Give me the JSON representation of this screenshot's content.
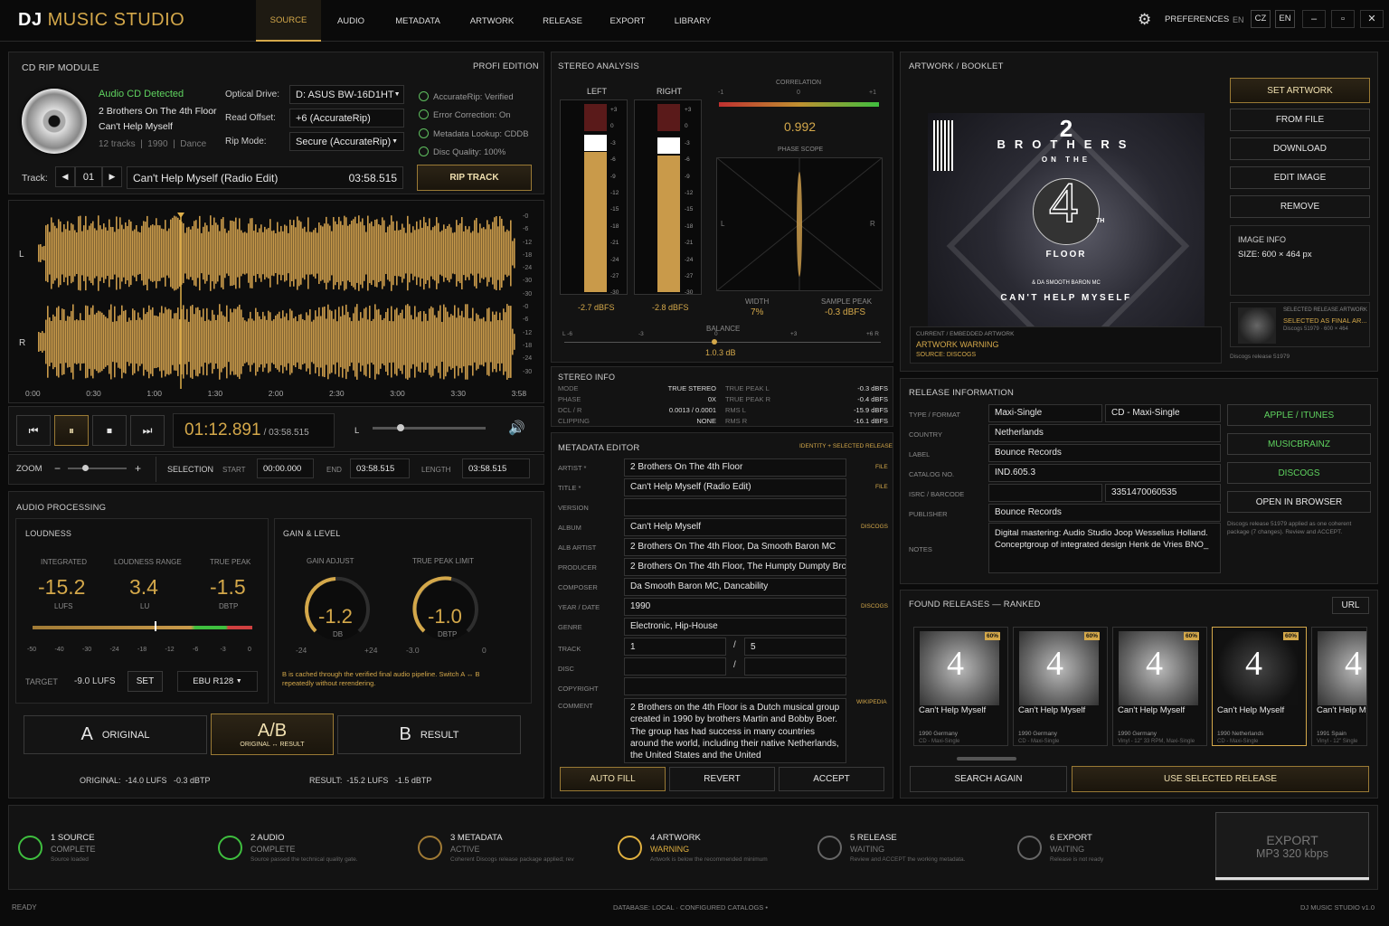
{
  "app": {
    "logo_dj": "DJ",
    "logo_rest": "MUSIC STUDIO",
    "tabs": [
      "SOURCE",
      "AUDIO",
      "METADATA",
      "ARTWORK",
      "RELEASE",
      "EXPORT",
      "LIBRARY"
    ],
    "active_tab": "SOURCE",
    "preferences": "PREFERENCES",
    "lang": [
      "EN",
      "CZ",
      "EN"
    ],
    "win": [
      "–",
      "▫",
      "✕"
    ]
  },
  "cdrip": {
    "title": "CD RIP MODULE",
    "edition": "PROFI EDITION",
    "detected": "Audio CD Detected",
    "artist": "2 Brothers On The 4th Floor",
    "album": "Can't Help Myself",
    "info": "12 tracks  |  1990  |  Dance",
    "drive_label": "Optical Drive:",
    "drive": "D: ASUS BW-16D1HT",
    "offset_label": "Read Offset:",
    "offset": "+6 (AccurateRip)",
    "mode_label": "Rip Mode:",
    "mode": "Secure (AccurateRip)",
    "checks": [
      "AccurateRip: Verified",
      "Error Correction: On",
      "Metadata Lookup: CDDB",
      "Disc Quality: 100%"
    ],
    "track_label": "Track:",
    "track_num": "01",
    "track_name": "Can't Help Myself (Radio Edit)",
    "track_time": "03:58.515",
    "rip": "RIP TRACK"
  },
  "wave": {
    "L": "L",
    "R": "R",
    "times": [
      "0:00",
      "0:30",
      "1:00",
      "1:30",
      "2:00",
      "2:30",
      "3:00",
      "3:30",
      "3:58"
    ],
    "db": [
      "-0",
      "-6",
      "-12",
      "-18",
      "-24",
      "-30",
      "-30",
      "-0",
      "-6",
      "-12",
      "-18",
      "-24",
      "-30"
    ]
  },
  "transport": {
    "time": "01:12.891",
    "total": "/ 03:58.515",
    "vol_label": "L"
  },
  "zoom": {
    "label": "ZOOM",
    "sel": "SELECTION",
    "start_l": "START",
    "start": "00:00.000",
    "end_l": "END",
    "end": "03:58.515",
    "len_l": "LENGTH",
    "len": "03:58.515"
  },
  "proc": {
    "title": "AUDIO PROCESSING",
    "loud": "LOUDNESS",
    "gain": "GAIN & LEVEL",
    "int_l": "INTEGRATED",
    "int": "-15.2",
    "int_u": "LUFS",
    "lra_l": "LOUDNESS RANGE",
    "lra": "3.4",
    "lra_u": "LU",
    "tp_l": "TRUE PEAK",
    "tp": "-1.5",
    "tp_u": "dBTP",
    "scale": [
      "-50",
      "-40",
      "-30",
      "-24",
      "-18",
      "-12",
      "-6",
      "-3",
      "0"
    ],
    "target_l": "TARGET",
    "target": "-9.0 LUFS",
    "set": "SET",
    "std": "EBU R128",
    "ga_l": "GAIN ADJUST",
    "ga": "-1.2",
    "ga_u": "dB",
    "ga_min": "-24",
    "ga_max": "+24",
    "tpl_l": "TRUE PEAK LIMIT",
    "tpl": "-1.0",
    "tpl_u": "dBTP",
    "tpl_min": "-3.0",
    "tpl_max": "0",
    "note": "B is cached through the verified final audio pipeline. Switch A ↔ B repeatedly without rerendering.",
    "a": "A",
    "a_l": "ORIGINAL",
    "ab": "A/B",
    "ab_l": "ORIGINAL ↔ RESULT",
    "b": "B",
    "b_l": "RESULT",
    "orig_stat": "ORIGINAL:  -14.0 LUFS   -0.3 dBTP",
    "res_stat": "RESULT:  -15.2 LUFS   -1.5 dBTP"
  },
  "stereo": {
    "title": "STEREO ANALYSIS",
    "left": "LEFT",
    "right": "RIGHT",
    "scale": [
      "+3",
      "0",
      "-3",
      "-6",
      "-9",
      "-12",
      "-15",
      "-18",
      "-21",
      "-24",
      "-27",
      "-30"
    ],
    "l_val": "-2.7 dBFS",
    "r_val": "-2.8 dBFS",
    "corr_l": "CORRELATION",
    "corr_m1": "-1",
    "corr_0": "0",
    "corr_p1": "+1",
    "corr": "0.992",
    "phase": "PHASE SCOPE",
    "ps_l": "L",
    "ps_r": "R",
    "width_l": "WIDTH",
    "width": "7%",
    "sp_l": "SAMPLE PEAK",
    "sp": "-0.3 dBFS",
    "bal_l": "BALANCE",
    "bal_scale": [
      "L -6",
      "-3",
      "0",
      "+3",
      "+6 R"
    ],
    "bal": "1.0.3 dB"
  },
  "sinfo": {
    "title": "STEREO INFO",
    "rows": [
      [
        "MODE",
        "TRUE STEREO",
        "TRUE PEAK L",
        "-0.3 dBFS"
      ],
      [
        "PHASE",
        "0X",
        "TRUE PEAK R",
        "-0.4 dBFS"
      ],
      [
        "DCL / R",
        "0.0013 / 0.0001",
        "RMS L",
        "-15.9 dBFS"
      ],
      [
        "CLIPPING",
        "NONE",
        "RMS R",
        "-16.1 dBFS"
      ]
    ]
  },
  "meta": {
    "title": "METADATA EDITOR",
    "sub": "IDENTITY + SELECTED RELEASE",
    "rows": [
      [
        "ARTIST *",
        "2 Brothers On The 4th Floor",
        "FILE"
      ],
      [
        "TITLE *",
        "Can't Help Myself (Radio Edit)",
        "FILE"
      ],
      [
        "VERSION",
        "",
        ""
      ],
      [
        "ALBUM",
        "Can't Help Myself",
        "DISCOGS"
      ],
      [
        "ALB ARTIST",
        "2 Brothers On The 4th Floor, Da Smooth Baron MC",
        ""
      ],
      [
        "PRODUCER",
        "2 Brothers On The 4th Floor, The Humpty Dumpty Brc",
        ""
      ],
      [
        "COMPOSER",
        "Da Smooth Baron MC, Dancability",
        ""
      ],
      [
        "YEAR / DATE",
        "1990",
        "DISCOGS"
      ],
      [
        "GENRE",
        "Electronic, Hip-House",
        ""
      ]
    ],
    "track_l": "TRACK",
    "track": "1",
    "track_of": "5",
    "disc_l": "DISC",
    "slash": "/",
    "copy_l": "COPYRIGHT",
    "comment_l": "COMMENT",
    "comment_src": "WIKIPEDIA",
    "comment": "2 Brothers on the 4th Floor is a Dutch musical group created in 1990 by brothers Martin and Bobby Boer. The group has had success in many countries around the world, including their native Netherlands, the United States and the United",
    "autofill": "AUTO FILL",
    "revert": "REVERT",
    "accept": "ACCEPT"
  },
  "art": {
    "title": "ARTWORK / BOOKLET",
    "cover_line1": "2",
    "cover_line2": "BROTHERS",
    "cover_line3": "ON THE",
    "cover_num": "4",
    "cover_th": "TH",
    "cover_floor": "FLOOR",
    "cover_mc": "& DA SMOOTH BARON MC",
    "cover_title": "CAN'T HELP MYSELF",
    "buttons": [
      "SET ARTWORK",
      "FROM FILE",
      "DOWNLOAD",
      "EDIT IMAGE",
      "REMOVE"
    ],
    "info_l": "IMAGE INFO",
    "size": "SIZE: 600 × 464 px",
    "cur_l": "CURRENT / EMBEDDED ARTWORK",
    "warn": "ARTWORK WARNING",
    "src": "SOURCE: DISCOGS",
    "sel_l": "SELECTED RELEASE ARTWORK",
    "sel_t": "SELECTED AS FINAL AR...",
    "sel_d": "Discogs 51979 · 600 × 464",
    "sel_n": "Discogs release 51979"
  },
  "rel": {
    "title": "RELEASE INFORMATION",
    "rows": [
      [
        "TYPE / FORMAT",
        "Maxi-Single",
        "CD - Maxi-Single"
      ],
      [
        "COUNTRY",
        "Netherlands",
        ""
      ],
      [
        "LABEL",
        "Bounce Records",
        ""
      ],
      [
        "CATALOG NO.",
        "IND.605.3",
        ""
      ],
      [
        "ISRC / BARCODE",
        "",
        "3351470060535"
      ],
      [
        "PUBLISHER",
        "Bounce Records",
        ""
      ]
    ],
    "notes_l": "NOTES",
    "notes": "Digital mastering: Audio Studio Joop Wesselius Holland. Conceptgroup of integrated design Henk de Vries BNO_",
    "links": [
      "APPLE / ITUNES",
      "MUSICBRAINZ",
      "DISCOGS",
      "OPEN IN BROWSER"
    ],
    "applied": "Discogs release 51979 applied as one coherent package (7 changes). Review and ACCEPT."
  },
  "found": {
    "title": "FOUND RELEASES — RANKED",
    "url": "URL",
    "items": [
      {
        "pct": "60%",
        "name": "Can't Help Myself",
        "yr": "1990 Germany",
        "fmt": "CD - Maxi-Single"
      },
      {
        "pct": "60%",
        "name": "Can't Help Myself",
        "yr": "1990 Germany",
        "fmt": "CD - Maxi-Single"
      },
      {
        "pct": "60%",
        "name": "Can't Help Myself",
        "yr": "1990 Germany",
        "fmt": "Vinyl - 12\" 33 RPM, Maxi-Single"
      },
      {
        "pct": "60%",
        "name": "Can't Help Myself",
        "yr": "1990 Netherlands",
        "fmt": "CD - Maxi-Single"
      },
      {
        "pct": "",
        "name": "Can't Help My",
        "yr": "1991 Spain",
        "fmt": "Vinyl - 12\" Single"
      }
    ],
    "search": "SEARCH AGAIN",
    "use": "USE SELECTED RELEASE"
  },
  "steps": [
    {
      "n": "1 SOURCE",
      "s": "COMPLETE",
      "d": "Source loaded",
      "c": "#3fbf3f"
    },
    {
      "n": "2 AUDIO",
      "s": "COMPLETE",
      "d": "Source passed the technical quality gate.",
      "c": "#3fbf3f"
    },
    {
      "n": "3 METADATA",
      "s": "ACTIVE",
      "d": "Coherent Discogs release package applied; rev",
      "c": "#a07a35"
    },
    {
      "n": "4 ARTWORK",
      "s": "WARNING",
      "d": "Artwork is below the recommended minimum",
      "c": "#e0b040"
    },
    {
      "n": "5 RELEASE",
      "s": "WAITING",
      "d": "Review and ACCEPT the working metadata.",
      "c": "#666"
    },
    {
      "n": "6 EXPORT",
      "s": "WAITING",
      "d": "Release is not ready",
      "c": "#666"
    }
  ],
  "export": {
    "l1": "EXPORT",
    "l2": "MP3 320 kbps"
  },
  "status": {
    "ready": "READY",
    "db": "DATABASE: LOCAL · CONFIGURED CATALOGS",
    "ver": "DJ MUSIC STUDIO v1.0"
  }
}
